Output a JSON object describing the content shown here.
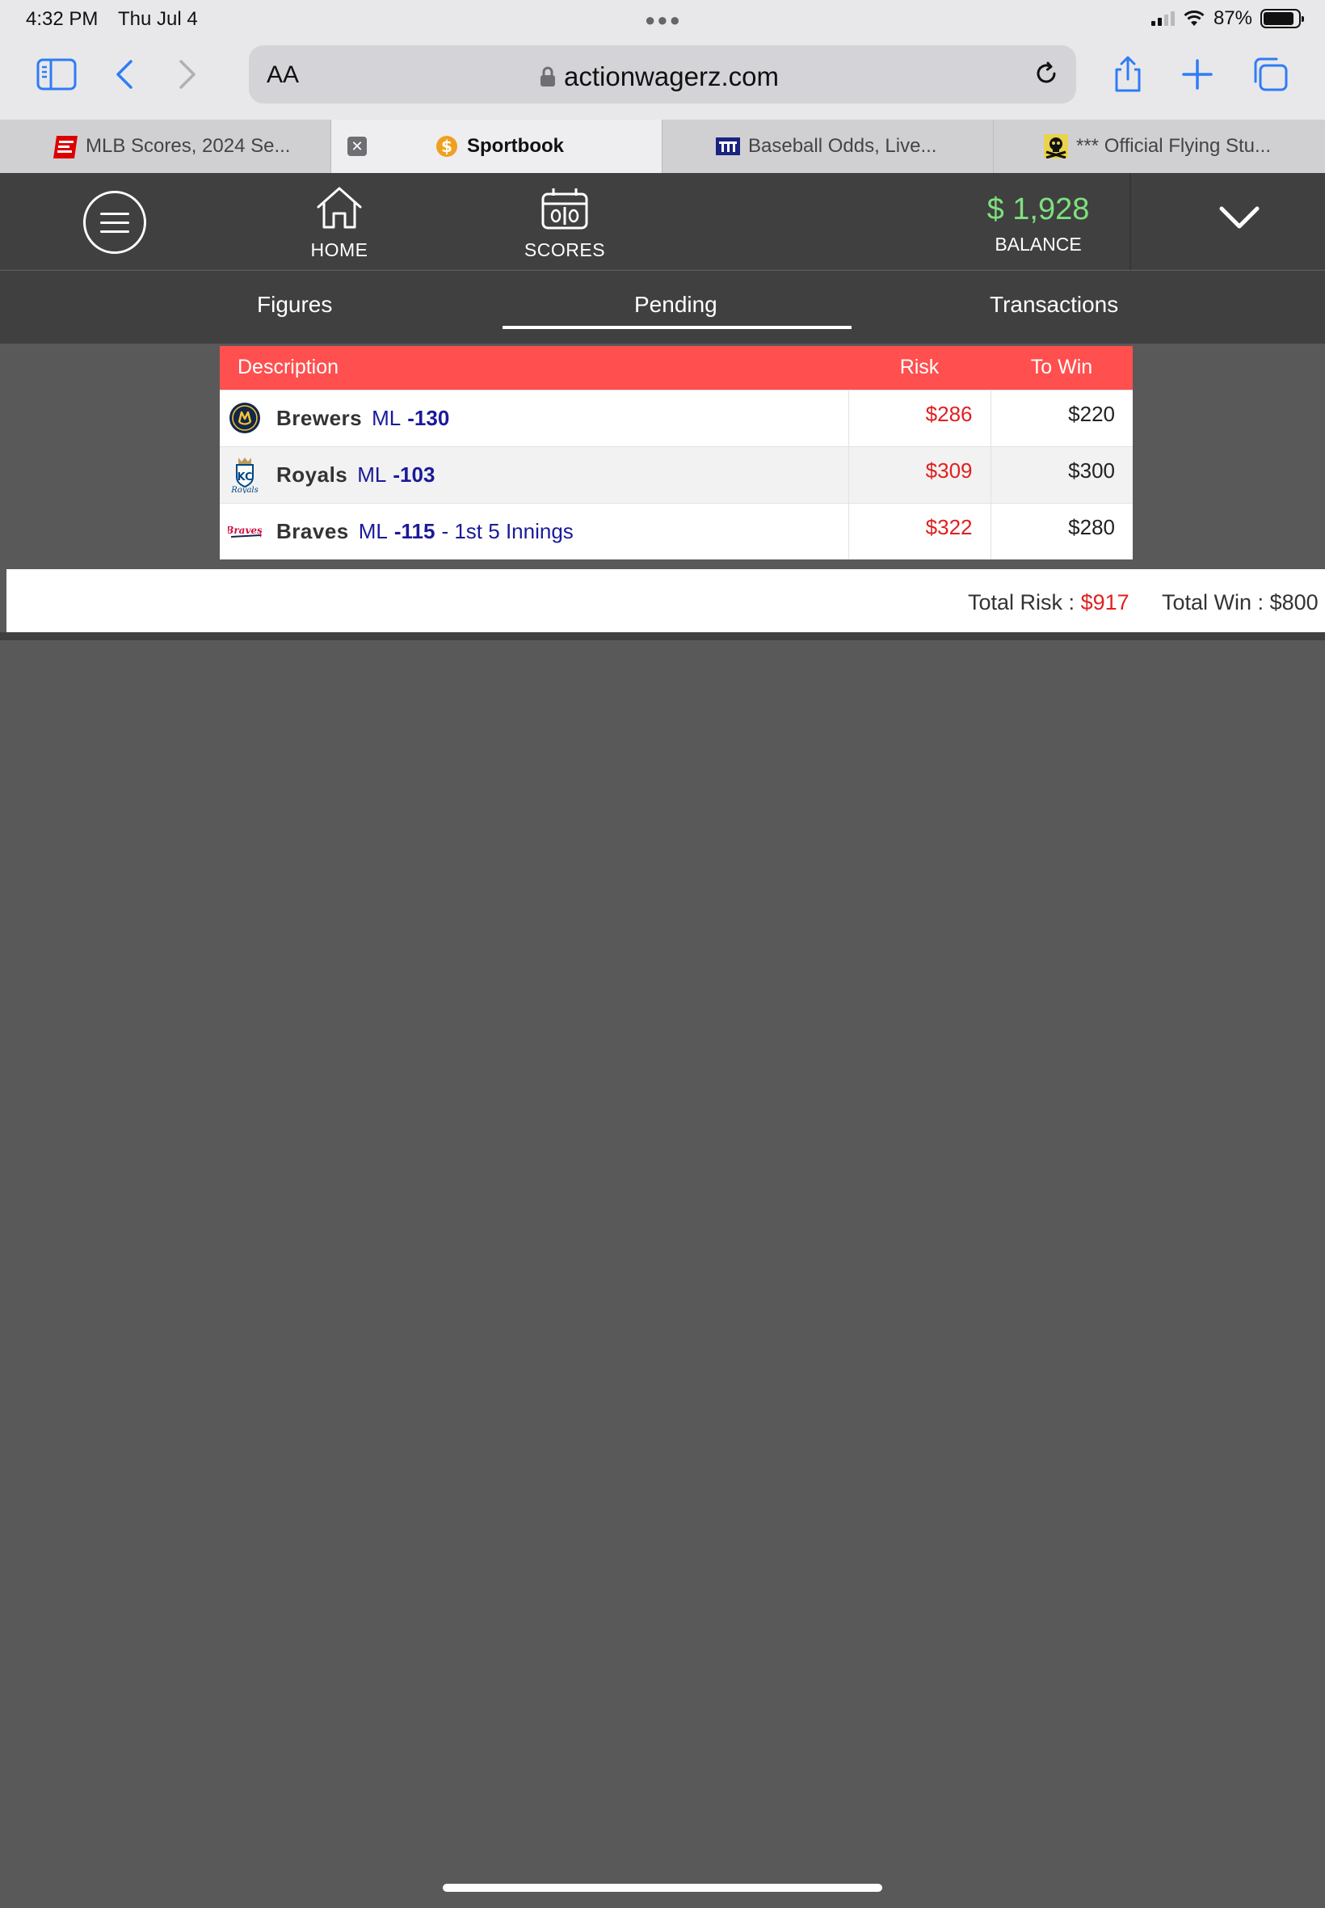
{
  "status_bar": {
    "time": "4:32 PM",
    "date": "Thu Jul 4",
    "battery": "87%"
  },
  "toolbar": {
    "text_size_label": "AA",
    "url": "actionwagerz.com"
  },
  "tabs": [
    {
      "label": "MLB Scores, 2024 Se...",
      "active": false
    },
    {
      "label": "Sportbook",
      "active": true
    },
    {
      "label": "Baseball Odds, Live...",
      "active": false
    },
    {
      "label": "*** Official Flying Stu...",
      "active": false
    }
  ],
  "header": {
    "home_label": "HOME",
    "scores_label": "SCORES",
    "balance_amount": "$ 1,928",
    "balance_label": "BALANCE"
  },
  "subtabs": {
    "figures": "Figures",
    "pending": "Pending",
    "transactions": "Transactions",
    "active": "Pending"
  },
  "table": {
    "columns": {
      "description": "Description",
      "risk": "Risk",
      "to_win": "To Win"
    },
    "rows": [
      {
        "team": "Brewers",
        "market": "ML",
        "odds": "-130",
        "extra": "",
        "risk": "$286",
        "to_win": "$220",
        "logo": "brewers-logo"
      },
      {
        "team": "Royals",
        "market": "ML",
        "odds": "-103",
        "extra": "",
        "risk": "$309",
        "to_win": "$300",
        "logo": "royals-logo"
      },
      {
        "team": "Braves",
        "market": "ML",
        "odds": "-115",
        "extra": "- 1st 5 Innings",
        "risk": "$322",
        "to_win": "$280",
        "logo": "braves-logo"
      }
    ]
  },
  "totals": {
    "risk_label": "Total Risk :",
    "risk_value": "$917",
    "win_label": "Total Win :",
    "win_value": "$800"
  },
  "colors": {
    "accent_red": "#ff4f4f",
    "balance_green": "#7ee07e",
    "link_blue": "#1a1a9a"
  }
}
